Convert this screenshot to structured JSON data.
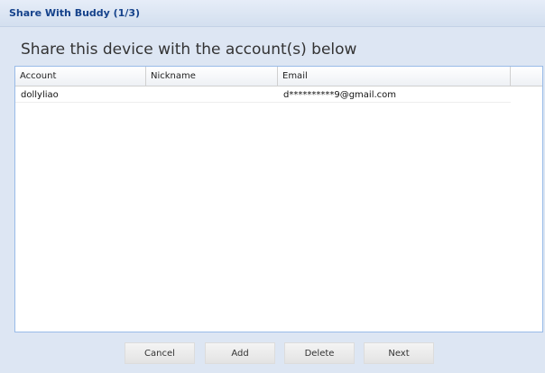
{
  "window": {
    "title": "Share With Buddy (1/3)"
  },
  "main": {
    "heading": "Share this device with the account(s) below"
  },
  "table": {
    "columns": [
      "Account",
      "Nickname",
      "Email"
    ],
    "rows": [
      {
        "account": "dollyliao",
        "nickname": "",
        "email": "d**********9@gmail.com"
      }
    ]
  },
  "buttons": {
    "cancel": "Cancel",
    "add": "Add",
    "delete": "Delete",
    "next": "Next"
  }
}
